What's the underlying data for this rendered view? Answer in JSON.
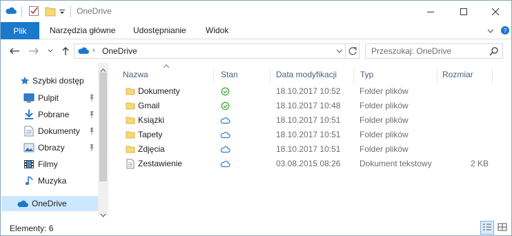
{
  "window": {
    "title": "OneDrive",
    "controls": [
      "minimize",
      "maximize",
      "close"
    ]
  },
  "ribbon": {
    "file_tab": "Plik",
    "tabs": [
      "Narzędzia główne",
      "Udostępnianie",
      "Widok"
    ]
  },
  "address": {
    "path_root_icon": "onedrive-cloud-icon",
    "location": "OneDrive",
    "search_placeholder": "Przeszukaj: OneDrive"
  },
  "nav": {
    "items": [
      {
        "label": "Szybki dostęp",
        "icon": "star-icon",
        "pinned": false
      },
      {
        "label": "Pulpit",
        "icon": "desktop-icon",
        "pinned": true
      },
      {
        "label": "Pobrane",
        "icon": "download-icon",
        "pinned": true
      },
      {
        "label": "Dokumenty",
        "icon": "documents-icon",
        "pinned": true
      },
      {
        "label": "Obrazy",
        "icon": "pictures-icon",
        "pinned": true
      },
      {
        "label": "Filmy",
        "icon": "videos-icon",
        "pinned": false
      },
      {
        "label": "Muzyka",
        "icon": "music-icon",
        "pinned": false
      },
      {
        "label": "OneDrive",
        "icon": "onedrive-cloud-icon",
        "selected": true
      }
    ]
  },
  "columns": [
    "Nazwa",
    "Stan",
    "Data modyfikacji",
    "Typ",
    "Rozmiar"
  ],
  "files": [
    {
      "name": "Dokumenty",
      "icon": "folder-icon",
      "status": "synced",
      "date": "18.10.2017 10:52",
      "type": "Folder plików",
      "size": ""
    },
    {
      "name": "Gmail",
      "icon": "folder-icon",
      "status": "synced",
      "date": "18.10.2017 10:48",
      "type": "Folder plików",
      "size": ""
    },
    {
      "name": "Książki",
      "icon": "folder-icon",
      "status": "cloud",
      "date": "18.10.2017 10:51",
      "type": "Folder plików",
      "size": ""
    },
    {
      "name": "Tapety",
      "icon": "folder-icon",
      "status": "cloud",
      "date": "18.10.2017 10:51",
      "type": "Folder plików",
      "size": ""
    },
    {
      "name": "Zdjęcia",
      "icon": "folder-icon",
      "status": "cloud",
      "date": "18.10.2017 10:51",
      "type": "Folder plików",
      "size": ""
    },
    {
      "name": "Zestawienie",
      "icon": "text-document-icon",
      "status": "cloud",
      "date": "03.08.2015 08:26",
      "type": "Dokument tekstowy",
      "size": "2 KB"
    }
  ],
  "status_bar": {
    "count_text": "Elementy: 6"
  },
  "colors": {
    "accent": "#1979ca",
    "folder": "#f8d775",
    "synced_green": "#3ea63e",
    "cloud_blue": "#2d7dd2"
  }
}
